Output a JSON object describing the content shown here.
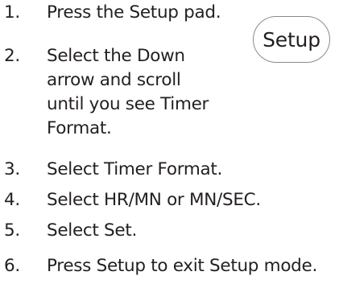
{
  "instructions": {
    "steps": [
      {
        "number": "1.",
        "lines": [
          "Press the Setup pad."
        ]
      },
      {
        "number": "2.",
        "lines": [
          "Select the Down",
          "arrow and scroll",
          "until you see Timer",
          "Format."
        ]
      },
      {
        "number": "3.",
        "lines": [
          "Select Timer Format."
        ]
      },
      {
        "number": "4.",
        "lines": [
          "Select HR/MN or MN/SEC."
        ]
      },
      {
        "number": "5.",
        "lines": [
          "Select Set."
        ]
      },
      {
        "number": "6.",
        "lines": [
          "Press Setup to exit Setup mode."
        ]
      }
    ]
  },
  "setup_pad": {
    "label": "Setup"
  }
}
